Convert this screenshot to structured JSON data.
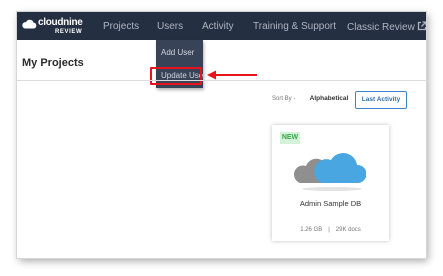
{
  "app": {
    "logo_main": "cloudnine",
    "logo_sub": "REVIEW"
  },
  "nav": {
    "items": [
      {
        "label": "Projects"
      },
      {
        "label": "Users"
      },
      {
        "label": "Activity"
      },
      {
        "label": "Training & Support"
      },
      {
        "label": "Classic Review"
      }
    ],
    "external_icon": "external-link-icon"
  },
  "users_menu": {
    "items": [
      {
        "label": "Add User"
      },
      {
        "label": "Update User"
      }
    ]
  },
  "annotation": {
    "highlight_color": "#e8141c",
    "arrow_icon": "left-arrow-icon"
  },
  "page": {
    "title": "My Projects"
  },
  "sort": {
    "label": "Sort By -",
    "options": [
      {
        "label": "Alphabetical",
        "selected": false
      },
      {
        "label": "Last Activity",
        "selected": true
      }
    ]
  },
  "project_card": {
    "badge": "NEW",
    "icon": "cloud-icon",
    "name": "Admin Sample DB",
    "size": "1.26 GB",
    "separator": "|",
    "docs": "29K docs"
  },
  "colors": {
    "navbar": "#242f42",
    "dropdown": "#384357",
    "accent": "#3c86c8",
    "badge_bg": "#d4f2d8",
    "badge_text": "#35a94a",
    "cloud_blue": "#4aa6e0",
    "cloud_gray": "#8f8f8f"
  }
}
